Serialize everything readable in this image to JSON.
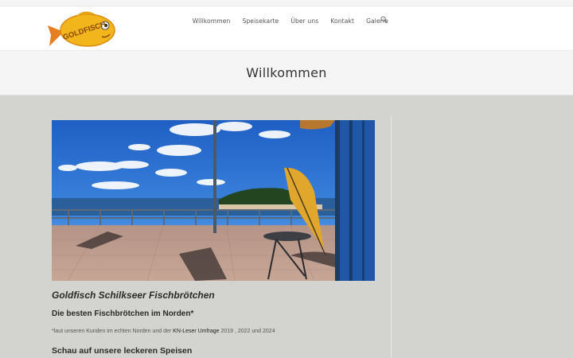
{
  "header": {
    "logo_text": "GOLDFISCH",
    "nav": [
      {
        "label": "Willkommen"
      },
      {
        "label": "Speisekarte"
      },
      {
        "label": "Über uns"
      },
      {
        "label": "Kontakt"
      },
      {
        "label": "Galerie"
      }
    ],
    "search_icon": "search-icon"
  },
  "title_band": {
    "title": "Willkommen"
  },
  "post": {
    "title": "Goldfisch Schilkseer Fischbrötchen",
    "subtitle": "Die besten Fischbrötchen im Norden*",
    "note_prefix": "*laut unseren Kunden im echten Norden und der ",
    "note_link": "KN-Leser Umfrage",
    "note_suffix": "  2019 , 2022 und 2024",
    "heading": "Schau auf unsere leckeren Speisen"
  },
  "colors": {
    "page_bg": "#d3d3cf",
    "header_bg": "#ffffff",
    "title_band_bg": "#f5f5f5",
    "logo_gold": "#f2b51b",
    "logo_orange": "#e67e22"
  }
}
